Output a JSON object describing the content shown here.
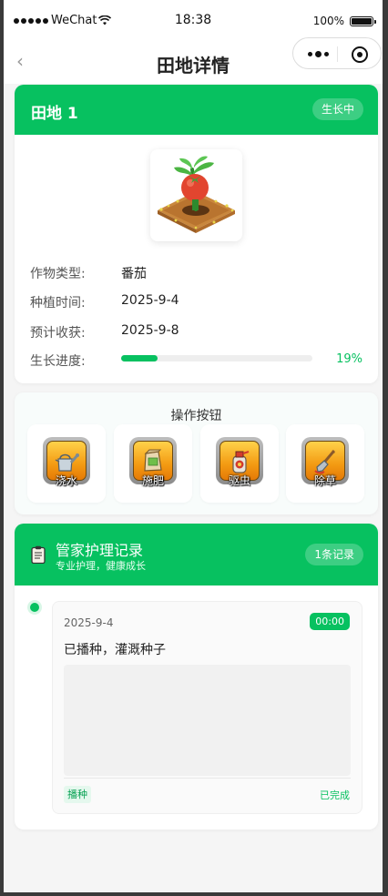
{
  "status_bar": {
    "carrier": "WeChat",
    "time": "18:38",
    "battery": "100%"
  },
  "nav": {
    "back_icon": "chevron-left-icon",
    "title": "田地详情"
  },
  "field": {
    "name": "田地 1",
    "status_badge": "生长中",
    "crop_image": "tomato-plant-on-soil",
    "rows": {
      "crop_type_label": "作物类型:",
      "crop_type_value": "番茄",
      "plant_time_label": "种植时间:",
      "plant_time_value": "2025-9-4",
      "harvest_label": "预计收获:",
      "harvest_value": "2025-9-8",
      "progress_label": "生长进度:"
    },
    "progress_percent": 19,
    "progress_text": "19%"
  },
  "operations": {
    "title": "操作按钮",
    "buttons": [
      {
        "label": "浇水",
        "icon": "watering-can-icon"
      },
      {
        "label": "施肥",
        "icon": "fertilizer-bag-icon"
      },
      {
        "label": "驱虫",
        "icon": "pesticide-spray-icon"
      },
      {
        "label": "除草",
        "icon": "shovel-icon"
      }
    ]
  },
  "care_log": {
    "title": "管家护理记录",
    "subtitle": "专业护理，健康成长",
    "count_badge": "1条记录",
    "entries": [
      {
        "date": "2025-9-4",
        "time": "00:00",
        "text": "已播种，灌溉种子",
        "tag": "播种",
        "status": "已完成"
      }
    ]
  },
  "colors": {
    "brand_green": "#07c160",
    "background": "#f5f5f5",
    "button_orange": "#f39a12"
  }
}
